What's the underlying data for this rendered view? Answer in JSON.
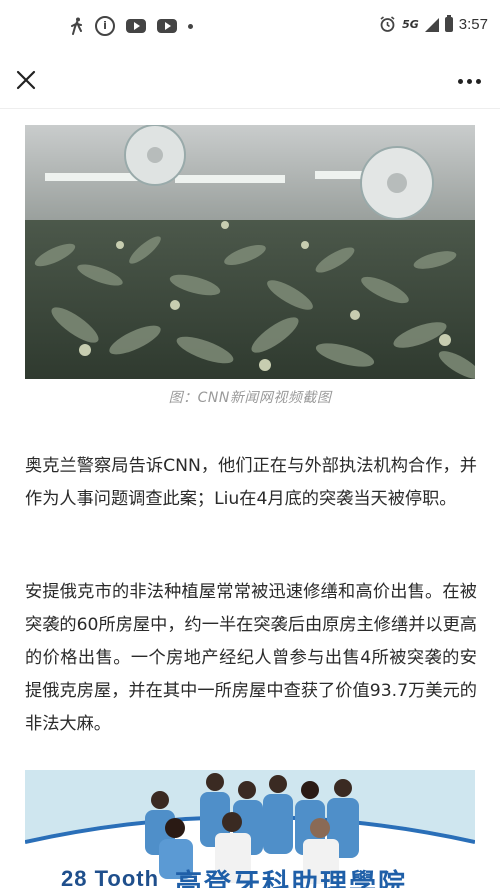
{
  "status_bar": {
    "time": "3:57",
    "network": "5G",
    "icons": [
      "walk-icon",
      "info-icon",
      "youtube-icon",
      "youtube-icon",
      "dot-icon",
      "alarm-icon",
      "signal-icon",
      "battery-icon"
    ]
  },
  "nav": {
    "close_icon": "close-icon",
    "more_icon": "more-icon"
  },
  "article": {
    "image_caption": "图：CNN新闻网视频截图",
    "paragraphs": [
      "奥克兰警察局告诉CNN，他们正在与外部执法机构合作，并作为人事问题调查此案；Liu在4月底的突袭当天被停职。",
      "安提俄克市的非法种植屋常常被迅速修缮和高价出售。在被突袭的60所房屋中，约一半在突袭后由原房主修缮并以更高的价格出售。一个房地产经纪人曾参与出售4所被突袭的安提俄克房屋，并在其中一所房屋中查获了价值93.7万美元的非法大麻。"
    ]
  },
  "ad": {
    "brand": "28 Tooth",
    "title": "高登牙科助理學院"
  },
  "colors": {
    "caption": "#9a9a9a",
    "ad_title": "#1f5fa8"
  }
}
